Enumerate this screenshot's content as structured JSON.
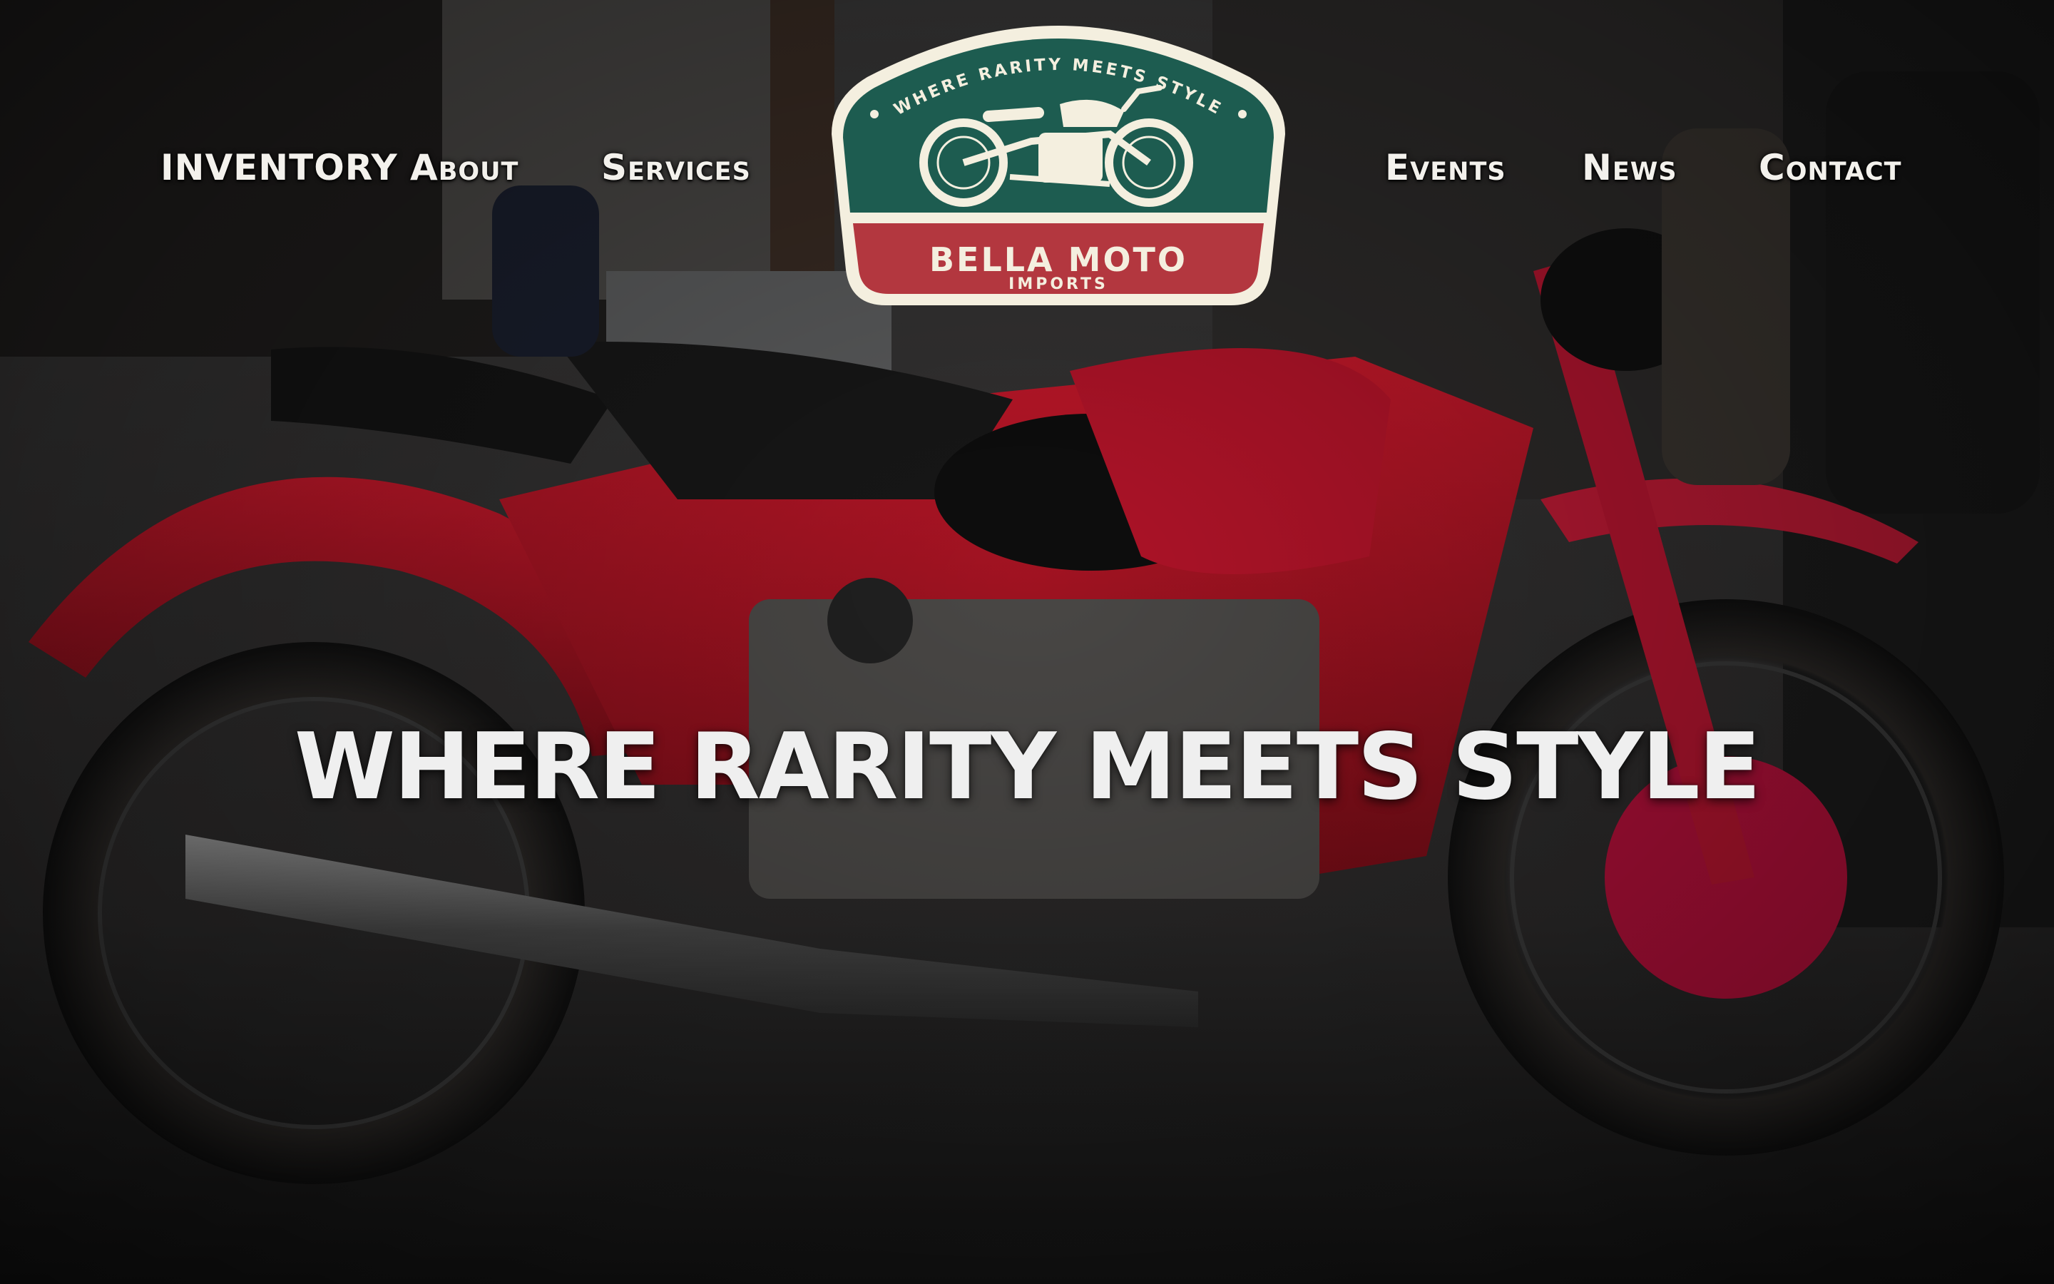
{
  "nav": {
    "inventory": "INVENTORY",
    "about": "About",
    "services": "Services",
    "events": "Events",
    "news": "News",
    "contact": "Contact"
  },
  "logo": {
    "arc_text": "WHERE RARITY MEETS STYLE",
    "name": "BELLA MOTO",
    "sub": "IMPORTS",
    "icon": "motorcycle-icon",
    "colors": {
      "green": "#1d5c50",
      "red": "#b3373f",
      "cream": "#f4efdf"
    }
  },
  "hero": {
    "headline": "WHERE RARITY MEETS STYLE",
    "background": "red vintage motorcycle photo"
  }
}
